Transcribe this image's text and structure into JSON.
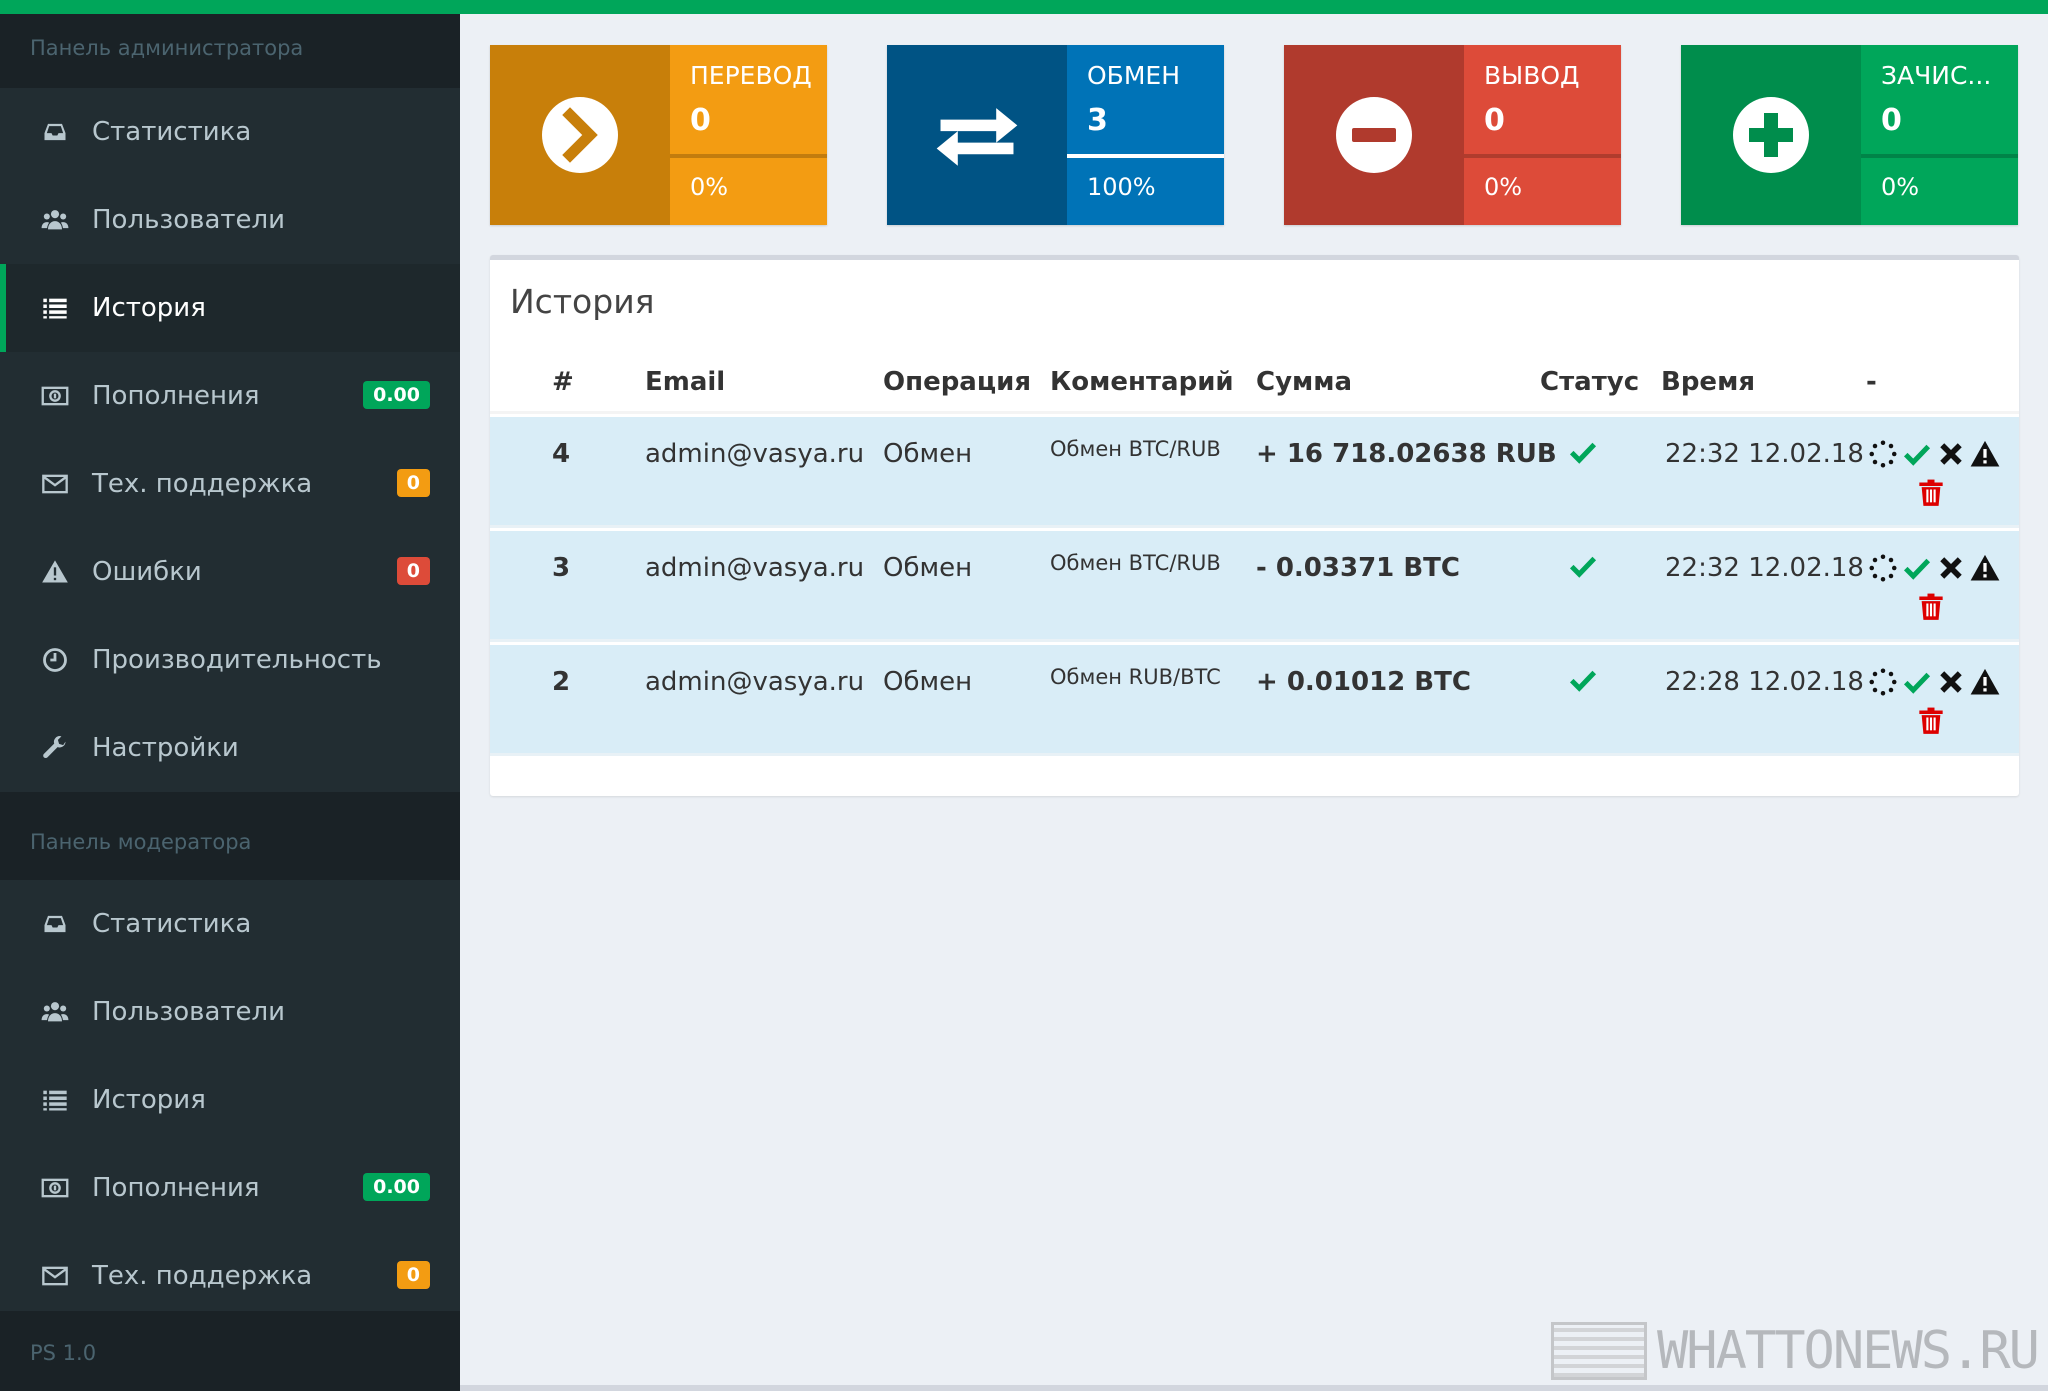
{
  "sidebar": {
    "admin_header": "Панель администратора",
    "admin_items": [
      {
        "label": "Статистика",
        "icon": "inbox-icon"
      },
      {
        "label": "Пользователи",
        "icon": "users-icon"
      },
      {
        "label": "История",
        "icon": "list-icon",
        "active": true
      },
      {
        "label": "Пополнения",
        "icon": "money-icon",
        "badge": "0.00"
      },
      {
        "label": "Тех. поддержка",
        "icon": "envelope-icon",
        "badge": "0"
      },
      {
        "label": "Ошибки",
        "icon": "warning-icon",
        "badge": "0"
      },
      {
        "label": "Производительность",
        "icon": "clock-icon"
      },
      {
        "label": "Настройки",
        "icon": "wrench-icon"
      }
    ],
    "mod_header": "Панель модератора",
    "mod_items": [
      {
        "label": "Статистика",
        "icon": "inbox-icon"
      },
      {
        "label": "Пользователи",
        "icon": "users-icon"
      },
      {
        "label": "История",
        "icon": "list-icon"
      },
      {
        "label": "Пополнения",
        "icon": "money-icon",
        "badge": "0.00"
      },
      {
        "label": "Тех. поддержка",
        "icon": "envelope-icon",
        "badge": "0"
      }
    ],
    "footer": "PS 1.0"
  },
  "colors": {
    "accent": "#00a65a",
    "sidebar_bg": "#222d32",
    "transfer": "#f39c12",
    "exchange": "#0073b7",
    "withdraw": "#dd4b39",
    "deposit": "#00a65a"
  },
  "infoboxes": [
    {
      "title": "ПЕРЕВОД",
      "value": "0",
      "percent_label": "0%",
      "progress": 0,
      "icon": "chevron-right-circle-icon"
    },
    {
      "title": "ОБМЕН",
      "value": "3",
      "percent_label": "100%",
      "progress": 100,
      "icon": "exchange-arrows-icon"
    },
    {
      "title": "ВЫВОД",
      "value": "0",
      "percent_label": "0%",
      "progress": 0,
      "icon": "minus-circle-icon"
    },
    {
      "title": "ЗАЧИС...",
      "value": "0",
      "percent_label": "0%",
      "progress": 0,
      "icon": "plus-circle-icon"
    }
  ],
  "history": {
    "title": "История",
    "columns": [
      "#",
      "Email",
      "Операция",
      "Коментарий",
      "Сумма",
      "Статус",
      "Время",
      "-"
    ],
    "rows": [
      {
        "id": "4",
        "email": "admin@vasya.ru",
        "operation": "Обмен",
        "comment": "Обмен BTC/RUB",
        "amount": "+ 16 718.02638 RUB",
        "status": "check-icon",
        "time": "22:32 12.02.18"
      },
      {
        "id": "3",
        "email": "admin@vasya.ru",
        "operation": "Обмен",
        "comment": "Обмен BTC/RUB",
        "amount": "- 0.03371 BTC",
        "status": "check-icon",
        "time": "22:32 12.02.18"
      },
      {
        "id": "2",
        "email": "admin@vasya.ru",
        "operation": "Обмен",
        "comment": "Обмен RUB/BTC",
        "amount": "+ 0.01012 BTC",
        "status": "check-icon",
        "time": "22:28 12.02.18"
      }
    ],
    "row_actions": [
      "spinner-icon",
      "check-icon",
      "times-icon",
      "warning-icon",
      "trash-icon"
    ]
  },
  "watermark": "WHATTONEWS.RU"
}
